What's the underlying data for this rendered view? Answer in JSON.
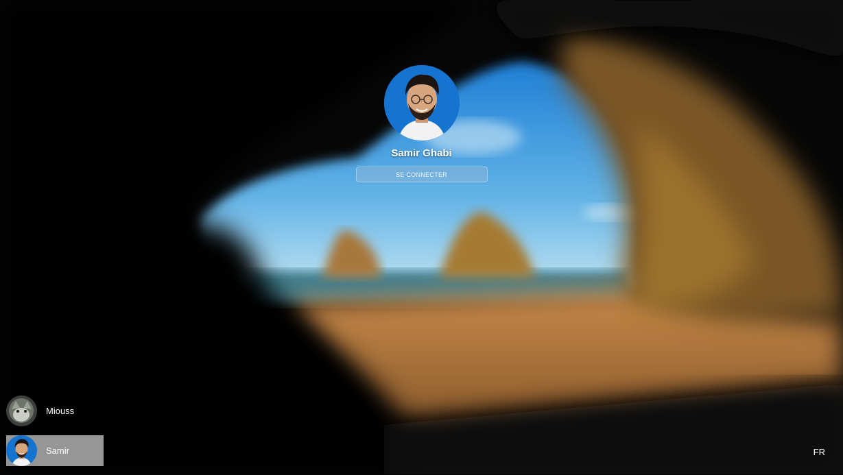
{
  "lock_screen": {
    "current_user": {
      "name": "Samir Ghabi",
      "avatar": "user-photo"
    },
    "signin_button": {
      "label": "SE CONNECTER"
    }
  },
  "users": [
    {
      "label": "Miouss",
      "avatar": "cat-photo",
      "selected": false
    },
    {
      "label": "Samir",
      "avatar": "user-photo",
      "selected": true
    }
  ],
  "language_indicator": {
    "label": "FR"
  },
  "colors": {
    "avatar_bg": "#1674d1",
    "selected_bg": "#c8c8c8"
  }
}
